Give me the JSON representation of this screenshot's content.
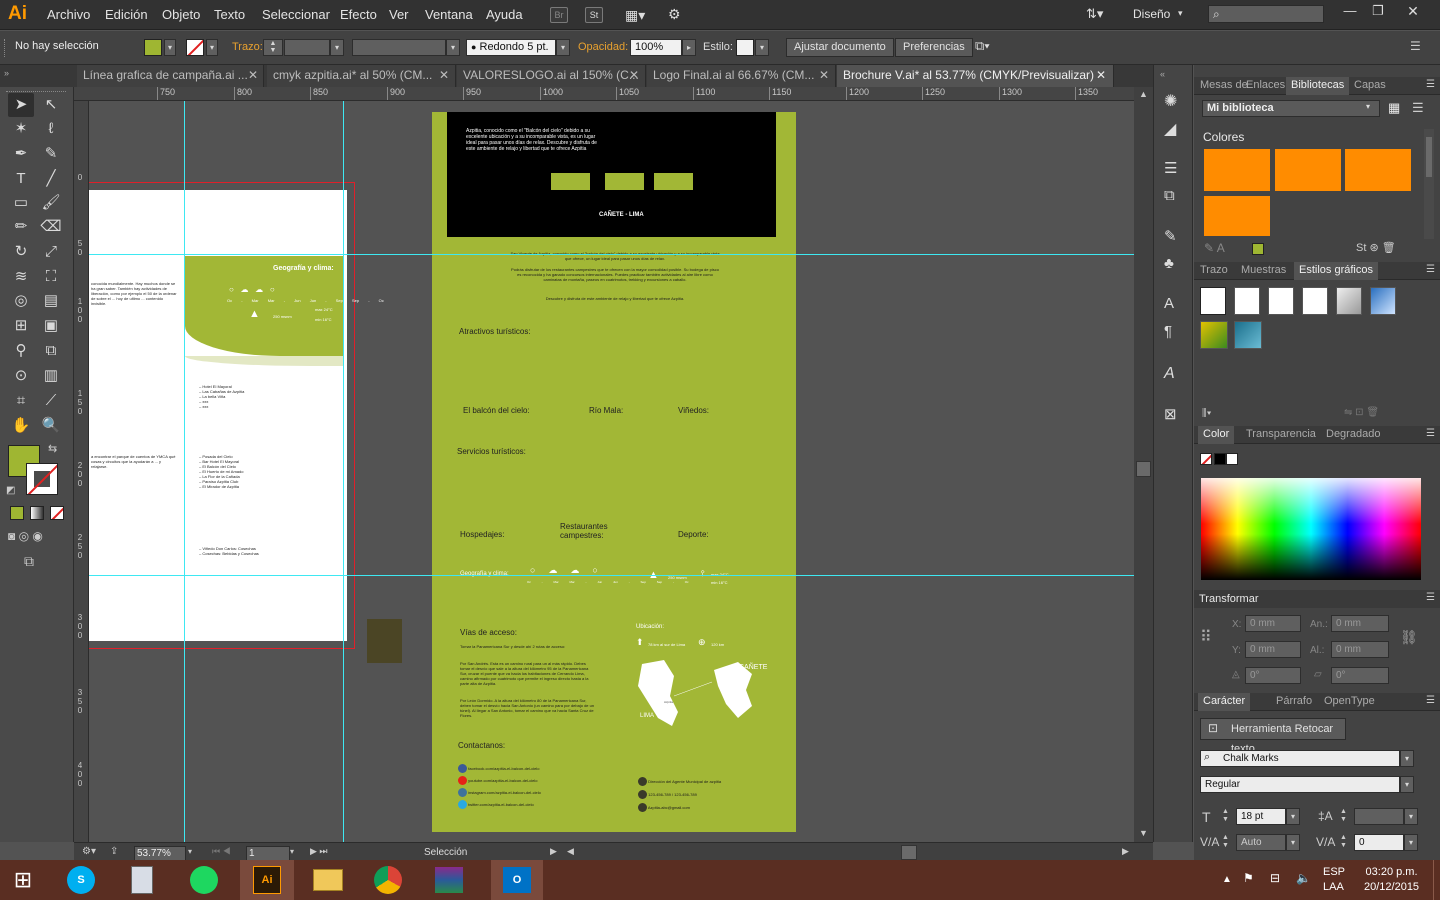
{
  "app": {
    "logo": "Ai"
  },
  "menu": [
    "Archivo",
    "Edición",
    "Objeto",
    "Texto",
    "Seleccionar",
    "Efecto",
    "Ver",
    "Ventana",
    "Ayuda"
  ],
  "menubar_right": {
    "workspace": "Diseño"
  },
  "menubar_buttons": {
    "br": "Br",
    "st": "St"
  },
  "window": {
    "min": "—",
    "restore": "❐",
    "close": "✕"
  },
  "control": {
    "selection": "No hay selección",
    "stroke_label": "Trazo:",
    "brush": "Redondo 5 pt.",
    "opacity_label": "Opacidad:",
    "opacity": "100%",
    "style_label": "Estilo:",
    "fit_btn": "Ajustar documento",
    "prefs_btn": "Preferencias"
  },
  "tabs": [
    {
      "label": "Línea grafica de campaña.ai ..."
    },
    {
      "label": "cmyk azpitia.ai* al 50% (CM..."
    },
    {
      "label": "VALORESLOGO.ai al 150% (C..."
    },
    {
      "label": "Logo Final.ai al 66.67% (CM..."
    },
    {
      "label": "Brochure V.ai* al 53.77% (CMYK/Previsualizar)"
    }
  ],
  "ruler_top": [
    "750",
    "800",
    "850",
    "900",
    "950",
    "1000",
    "1050",
    "1100",
    "1150",
    "1200",
    "1250",
    "1300",
    "1350"
  ],
  "ruler_left": [
    {
      "v": "0"
    },
    {
      "v": "5 0"
    },
    {
      "v": "1 0 0"
    },
    {
      "v": "1 5 0"
    },
    {
      "v": "2 0 0"
    },
    {
      "v": "2 5 0"
    },
    {
      "v": "3 0 0"
    },
    {
      "v": "3 5 0"
    },
    {
      "v": "4 0 0"
    }
  ],
  "status": {
    "zoom": "53.77%",
    "page": "1",
    "tool": "Selección"
  },
  "doc_left": {
    "title": "Geografía y clima:",
    "seasons": [
      "Oc - Mar",
      "Mar - Jun",
      "Jun - Sep",
      "Sep - Oc"
    ],
    "altitude": "250 msnm",
    "temps": [
      "max 24°C",
      "min 16°C"
    ],
    "intro": "conocida mundialmente. Hay muchos donde se ha gran saber. También hay actividades de liberación, como por ejemplo el 50 de la ordenar de sobre el ... hoy de ultimo ... contenido invisible.",
    "list1": [
      "– Hotel El Mayoral",
      "– Las Cabañas de Azpitia",
      "– La bella Viña",
      "– xxx",
      "– xxx"
    ],
    "list2": [
      "– Posada del Cielo",
      "– Bar Hotel El Mayoral",
      "– El Balcón del Cielo",
      "– El Huerto de mi Amado",
      "– La Flor de la Cañada",
      "– Paraíso Azpitia Club",
      "– El Mirador de Azpitia"
    ],
    "list3": [
      "– Viñedo Don Carlos: Cosechas",
      "– Cosechas: Bebidas y Cosechas"
    ],
    "side": "a encontrar el parque de cuentos de YMCA qué cosas y circuitos que la ayudarán a ... y relajarse."
  },
  "doc_right": {
    "top_text": "Azpitia, conocido como el \"Balcón del cielo\" debido a su excelente ubicación y a su incomparable vista, es un lugar ideal para pasar unos días de relax. Descubre y disfruta de este ambiente de relajo y libertad que te ofrece Azpitia",
    "place": "CAÑETE - LIMA",
    "intro": "San Vicente de Azpitia, conocido como el \"balcón del cielo\" debido a su excelente ubicación y a su incomparable vista que ofrece, un lugar ideal para pasar unos días de relax.",
    "intro2": "Podrás disfrutar de los restaurantes campestres que te ofrecen con la mayor comodidad posible. Su bodega de pisco es reconocida y ha ganado concursos internacionales. Puedes practicar también actividades al aire libre como caminatas de montaña, paseos en cuatrimotos, trekking y excursiones a caballo.",
    "intro3": "Descubre y disfruta de este ambiente de relajo y libertad que te ofrece Azpitia.",
    "attractions": "Atractivos turísticos:",
    "a1": "El balcón del cielo:",
    "a2": "Río Mala:",
    "a3": "Viñedos:",
    "services": "Servicios turísticos:",
    "s1": "Hospedajes:",
    "s2": "Restaurantes campestres:",
    "s3": "Deporte:",
    "geo": "Geografía y clima:",
    "seasons": [
      "Oc - Mar",
      "Mar - Jun",
      "Jun - Sep",
      "Sep - Oc"
    ],
    "altitude": "250 msnm",
    "temps": [
      "max 24°C",
      "min 16°C"
    ],
    "access": "Vías de acceso:",
    "access_p1": "Tomar la Panamericana Sur y desde ahí 2 rutas de acceso:",
    "access_p2": "Por San Andrés. Esta es un camino rural para un al más rápido. Debes tomar el desvío que sale a la altura del kilómetro 95 de la Panamericana Sur, cruzar el puente que va hacia los habitaciones de Cerrando Lima, camino afirmado por cuatrimoto que permite el ingreso directo hasta a la parte alta de Azpitia.",
    "access_p3": "Por León Dormido. A la altura del kilómetro 80 de la Panamericana Sur, deben tomar el desvío hacia San Antonio (un camino para por debajo de un túnel). Al llegar a San Antonio, tomar el camino que va hacia Santa Cruz de Flores.",
    "location": "Ubicación:",
    "loc1": "78 km al sur de Lima",
    "loc2": "120 km",
    "map_lima": "LIMA",
    "map_canete": "CAÑETE",
    "map_azpitia": "Azpitia",
    "contacts": "Contactanos:",
    "c1": "facebook.com/azpitia-el-balcon-del-cielo",
    "c2": "youtube.com/azpitia-el-balcon-del-cielo",
    "c3": "instagram.com/azpitia-el-balcon-del-cielo",
    "c4": "twitter.com/azpitia-el-balcon-del-cielo",
    "c5": "Dirección del Agente Municipal de azpitia",
    "c6": "123-456-789 / 123-456-789",
    "c7": "Azpitia-abc@gmail.com"
  },
  "panels": {
    "lib_tabs": [
      "Mesas de",
      "Enlaces",
      "Bibliotecas",
      "Capas"
    ],
    "library": "Mi biblioteca",
    "colors_label": "Colores",
    "swatch_color": "#ff8c00",
    "graphic_tabs": [
      "Trazo",
      "Muestras",
      "Estilos gráficos"
    ],
    "color_tabs": [
      "Color",
      "Transparencia",
      "Degradado"
    ],
    "transform": {
      "title": "Transformar",
      "x_label": "X:",
      "x": "0 mm",
      "w_label": "An.:",
      "w": "0 mm",
      "y_label": "Y:",
      "y": "0 mm",
      "h_label": "Al.:",
      "h": "0 mm",
      "rot": "0°",
      "shear": "0°"
    },
    "char_tabs": [
      "Carácter",
      "Párrafo",
      "OpenType"
    ],
    "touch_btn": "Herramienta Retocar texto",
    "font": "Chalk Marks",
    "style": "Regular",
    "size": "18 pt",
    "kerning": "Auto",
    "tracking": "0"
  },
  "taskbar": {
    "lang1": "ESP",
    "lang2": "LAA",
    "time": "03:20 p.m.",
    "date": "20/12/2015",
    "ai_label": "Ai"
  },
  "colors": {
    "doc_green": "#a2b736",
    "fill_swatch": "#9fb632",
    "accent": "#ff8c00"
  }
}
